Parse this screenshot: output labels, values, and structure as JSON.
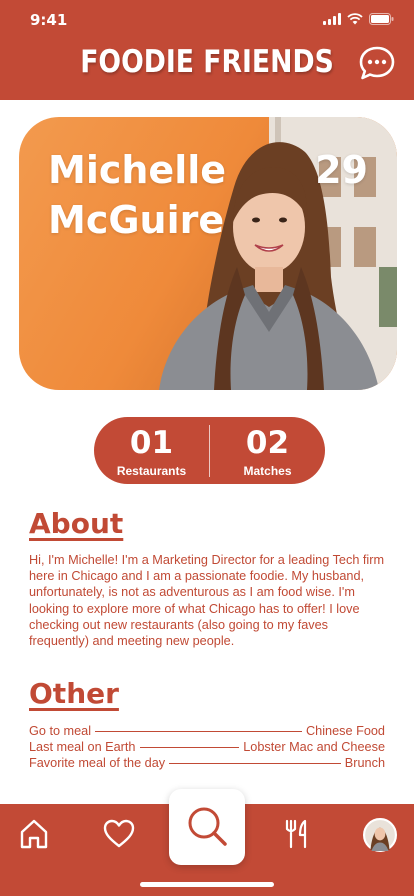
{
  "status_bar": {
    "time": "9:41"
  },
  "header": {
    "title": "FOODIE FRIENDS",
    "chat_icon": "chat-bubble-icon"
  },
  "profile": {
    "first_name": "Michelle",
    "last_name": "McGuire",
    "age": "29"
  },
  "stats": [
    {
      "value": "01",
      "label": "Restaurants"
    },
    {
      "value": "02",
      "label": "Matches"
    }
  ],
  "about": {
    "heading": "About",
    "text": "Hi, I'm Michelle!  I'm a Marketing Director for a leading Tech firm here in Chicago and I am a passionate foodie.  My husband, unfortunately, is not as adventurous as I am food wise.  I'm looking to explore more of what Chicago has to offer!  I love checking out new restaurants (also going to my faves frequently) and meeting new people."
  },
  "other": {
    "heading": "Other",
    "items": [
      {
        "label": "Go to meal",
        "value": "Chinese Food"
      },
      {
        "label": "Last meal on Earth",
        "value": "Lobster Mac and Cheese"
      },
      {
        "label": "Favorite meal of the day",
        "value": "Brunch"
      }
    ]
  },
  "nav": {
    "items": [
      "home-icon",
      "heart-icon",
      "search-icon",
      "fork-knife-icon",
      "profile-avatar"
    ]
  },
  "colors": {
    "brand": "#c24a36",
    "accent_orange": "#f39a4e"
  }
}
